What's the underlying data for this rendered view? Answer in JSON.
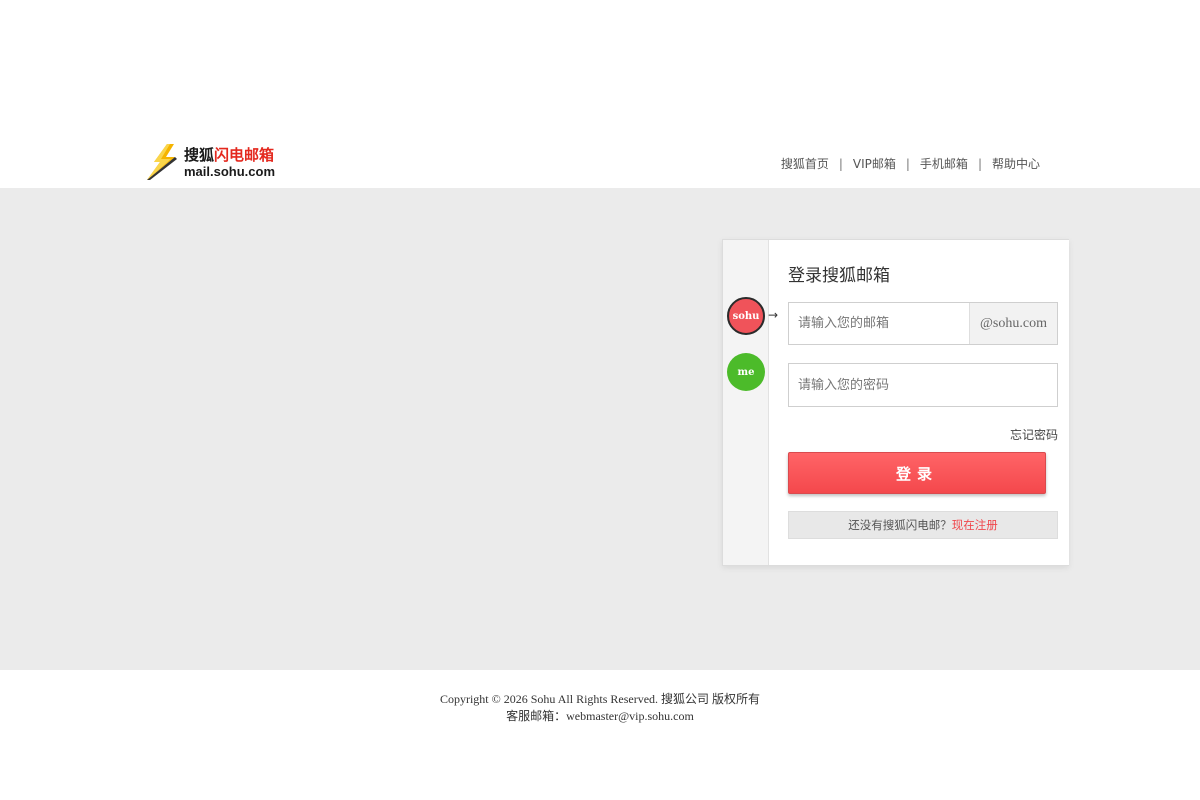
{
  "header": {
    "logo_cn_dark": "搜狐",
    "logo_cn_red": "闪电邮箱",
    "logo_en": "mail.sohu.com",
    "nav": [
      {
        "label": "搜狐首页"
      },
      {
        "label": "VIP邮箱"
      },
      {
        "label": "手机邮箱"
      },
      {
        "label": "帮助中心"
      }
    ],
    "nav_separator": "|"
  },
  "login": {
    "title": "登录搜狐邮箱",
    "badges": [
      {
        "label": "sohu",
        "color": "#f0535a"
      },
      {
        "label": "me",
        "color": "#4cbb2a"
      }
    ],
    "arrow": "→",
    "email": {
      "value": "",
      "placeholder": "请输入您的邮箱",
      "suffix": "@sohu.com"
    },
    "password": {
      "value": "",
      "placeholder": "请输入您的密码"
    },
    "forgot_label": "忘记密码",
    "submit_label": "登录",
    "register_prompt": "还没有搜狐闪电邮？",
    "register_link": "现在注册"
  },
  "footer": {
    "copyright": "Copyright © 2026 Sohu All Rights Reserved. 搜狐公司 版权所有",
    "contact": "客服邮箱：webmaster@vip.sohu.com"
  },
  "colors": {
    "accent_red": "#f4484c",
    "accent_green": "#4cbb2a",
    "band_gray": "#ebebeb"
  }
}
